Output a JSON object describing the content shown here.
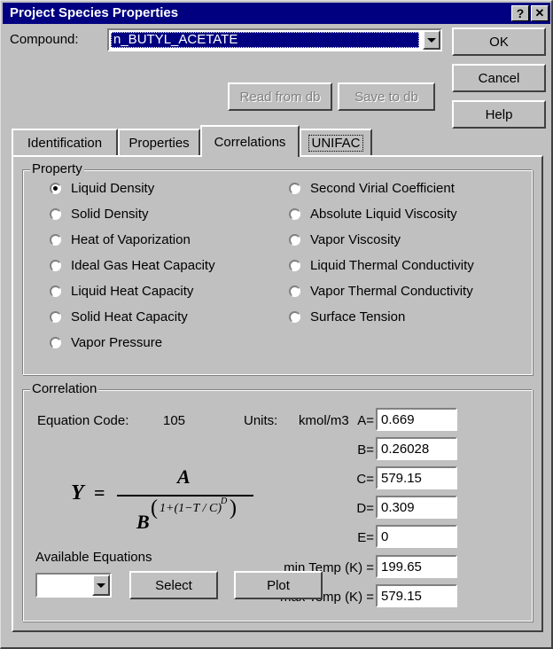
{
  "window": {
    "title": "Project Species Properties",
    "help_glyph": "?",
    "close_glyph": "✕"
  },
  "compound": {
    "label": "Compound:",
    "value": "n_BUTYL_ACETATE"
  },
  "buttons": {
    "ok": "OK",
    "cancel": "Cancel",
    "help": "Help",
    "read_db": "Read from db",
    "save_db": "Save to db",
    "select": "Select",
    "plot": "Plot"
  },
  "tabs": [
    {
      "label": "Identification"
    },
    {
      "label": "Properties"
    },
    {
      "label": "Correlations",
      "active": true
    },
    {
      "label": "UNIFAC"
    }
  ],
  "property": {
    "title": "Property",
    "left": [
      "Liquid Density",
      "Solid Density",
      "Heat of Vaporization",
      "Ideal Gas Heat Capacity",
      "Liquid Heat Capacity",
      "Solid Heat Capacity",
      "Vapor Pressure"
    ],
    "right": [
      "Second Virial Coefficient",
      "Absolute Liquid Viscosity",
      "Vapor Viscosity",
      "Liquid Thermal Conductivity",
      "Vapor Thermal Conductivity",
      "Surface Tension"
    ],
    "selected": "Liquid Density"
  },
  "correlation": {
    "title": "Correlation",
    "eq_code_label": "Equation Code:",
    "eq_code": "105",
    "units_label": "Units:",
    "units": "kmol/m3",
    "available_label": "Available Equations",
    "params": [
      {
        "label": "A=",
        "value": "0.669"
      },
      {
        "label": "B=",
        "value": "0.26028"
      },
      {
        "label": "C=",
        "value": "579.15"
      },
      {
        "label": "D=",
        "value": "0.309"
      },
      {
        "label": "E=",
        "value": "0"
      }
    ],
    "min_temp_label": "min Temp (K) =",
    "min_temp": "199.65",
    "max_temp_label": "max Temp (K) =",
    "max_temp": "579.15"
  },
  "equation": {
    "y": "Y",
    "equals": "=",
    "numerator": "A",
    "base": "B",
    "exponent": "1+(1−T / C)",
    "power": "D"
  }
}
